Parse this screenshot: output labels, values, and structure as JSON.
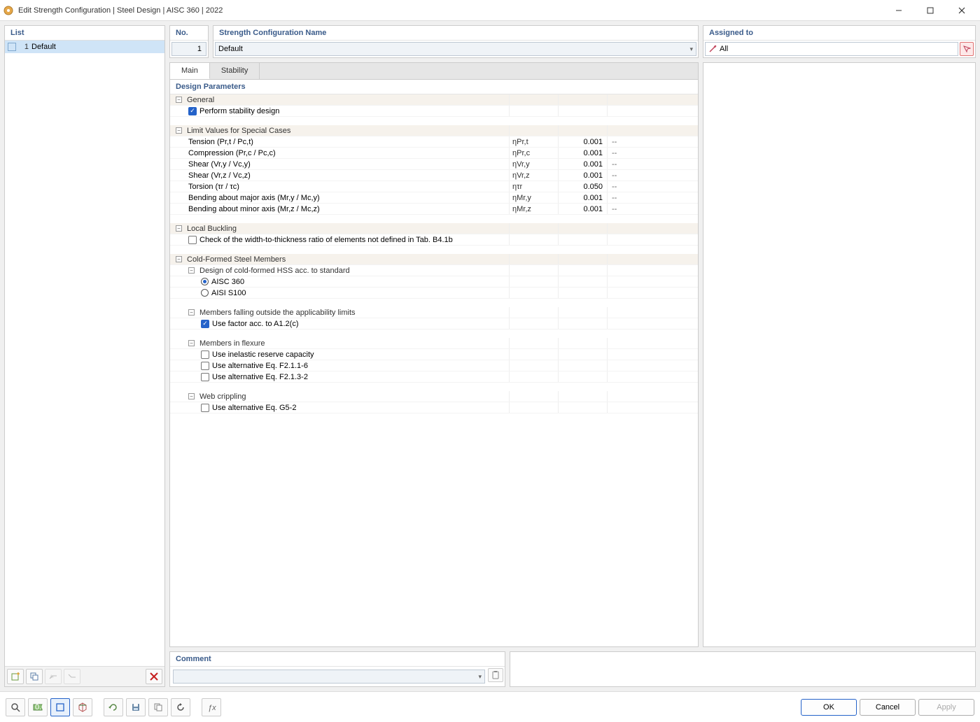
{
  "window": {
    "title": "Edit Strength Configuration | Steel Design | AISC 360 | 2022"
  },
  "left": {
    "header": "List",
    "rows": [
      {
        "num": "1",
        "name": "Default"
      }
    ]
  },
  "top": {
    "no_label": "No.",
    "no_value": "1",
    "name_label": "Strength Configuration Name",
    "name_value": "Default",
    "assigned_label": "Assigned to",
    "assigned_value": "All"
  },
  "tabs": {
    "main": "Main",
    "stability": "Stability"
  },
  "params_header": "Design Parameters",
  "groups": {
    "general": "General",
    "perform_stability": "Perform stability design",
    "limit_values": "Limit Values for Special Cases",
    "local_buckling": "Local Buckling",
    "width_thickness": "Check of the width-to-thickness ratio of elements not defined in Tab. B4.1b",
    "cold_formed": "Cold-Formed Steel Members",
    "design_cf_hss": "Design of cold-formed HSS acc. to standard",
    "aisc360": "AISC 360",
    "aisi_s100": "AISI S100",
    "members_outside": "Members falling outside the applicability limits",
    "use_factor_a12c": "Use factor acc. to A1.2(c)",
    "members_flexure": "Members in flexure",
    "inelastic_reserve": "Use inelastic reserve capacity",
    "alt_f2116": "Use alternative Eq. F2.1.1-6",
    "alt_f2132": "Use alternative Eq. F2.1.3-2",
    "web_crippling": "Web crippling",
    "alt_g52": "Use alternative Eq. G5-2"
  },
  "limit_rows": [
    {
      "label": "Tension (Pr,t / Pc,t)",
      "sym": "ηPr,t",
      "val": "0.001",
      "unit": "--"
    },
    {
      "label": "Compression (Pr,c / Pc,c)",
      "sym": "ηPr,c",
      "val": "0.001",
      "unit": "--"
    },
    {
      "label": "Shear (Vr,y / Vc,y)",
      "sym": "ηVr,y",
      "val": "0.001",
      "unit": "--"
    },
    {
      "label": "Shear (Vr,z / Vc,z)",
      "sym": "ηVr,z",
      "val": "0.001",
      "unit": "--"
    },
    {
      "label": "Torsion (τr / τc)",
      "sym": "ητr",
      "val": "0.050",
      "unit": "--"
    },
    {
      "label": "Bending about major axis (Mr,y / Mc,y)",
      "sym": "ηMr,y",
      "val": "0.001",
      "unit": "--"
    },
    {
      "label": "Bending about minor axis (Mr,z / Mc,z)",
      "sym": "ηMr,z",
      "val": "0.001",
      "unit": "--"
    }
  ],
  "comment": {
    "label": "Comment",
    "value": ""
  },
  "buttons": {
    "ok": "OK",
    "cancel": "Cancel",
    "apply": "Apply"
  }
}
